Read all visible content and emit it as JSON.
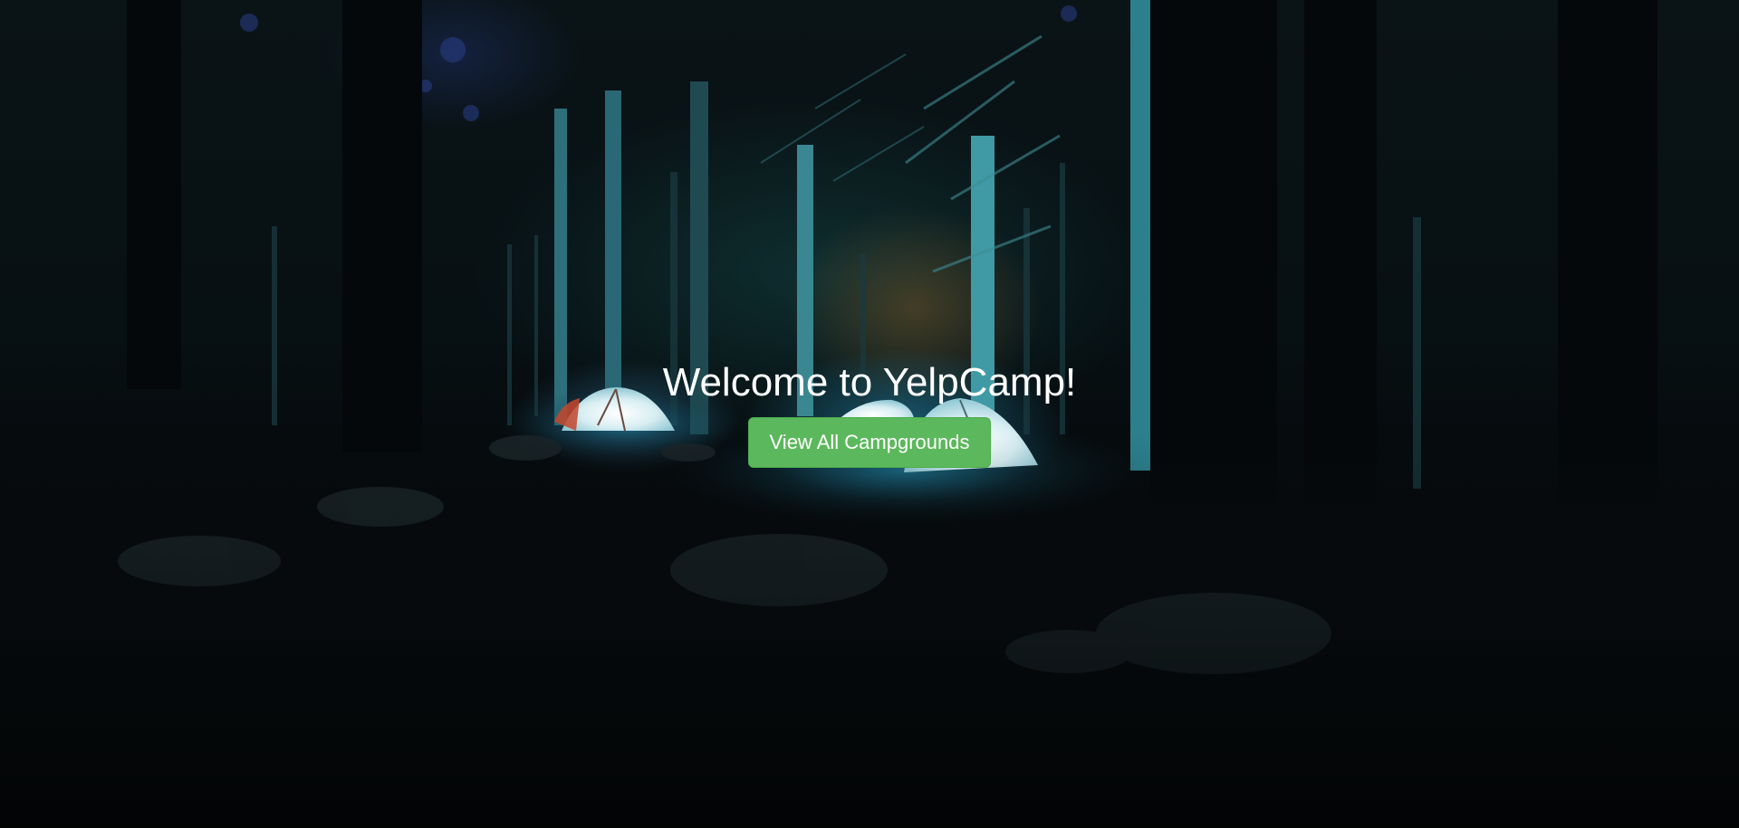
{
  "landing": {
    "title": "Welcome to YelpCamp!",
    "button_label": "View All Campgrounds"
  },
  "colors": {
    "button_background": "#5cb85c",
    "button_border": "#4cae4c",
    "text": "#ffffff"
  },
  "background_image": {
    "icon": "night-forest-campsite-photo"
  }
}
